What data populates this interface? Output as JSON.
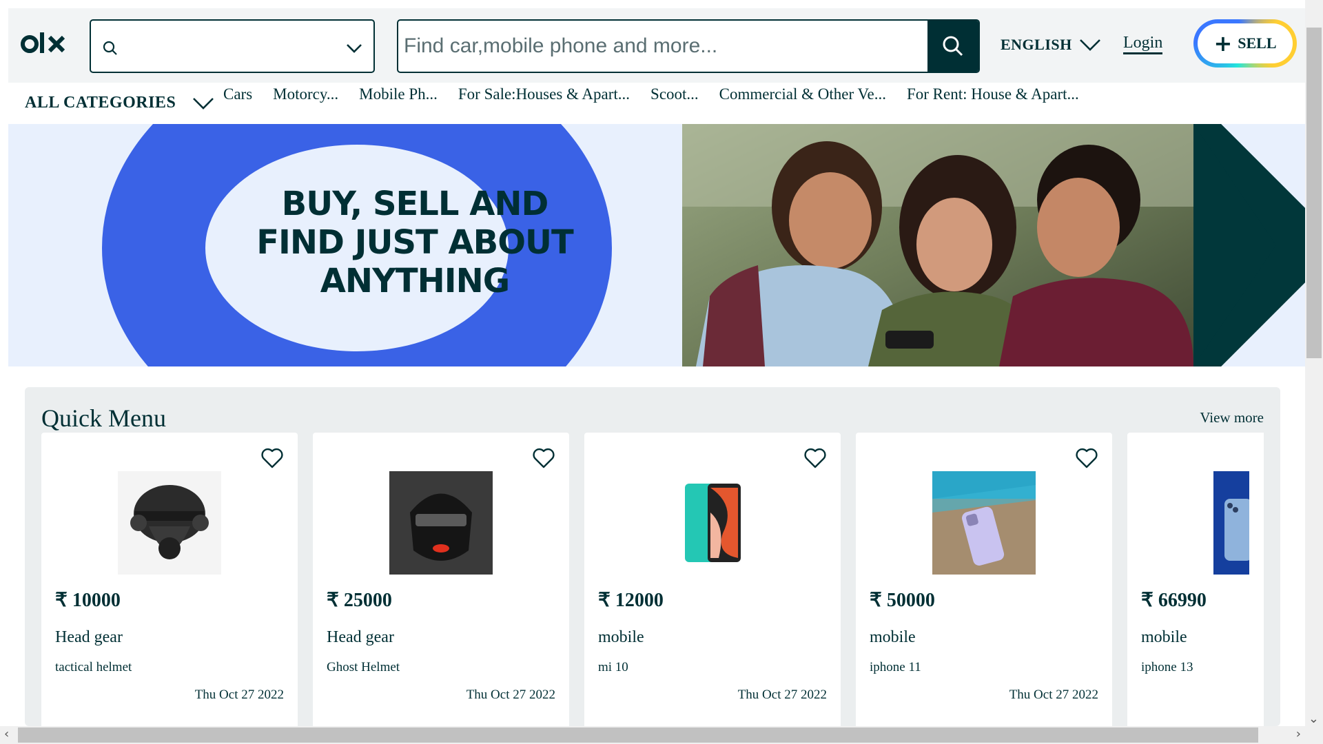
{
  "header": {
    "logo_text": "olx",
    "location_placeholder": "",
    "search_placeholder": "Find car,mobile phone and more...",
    "language": "ENGLISH",
    "login": "Login",
    "sell": "SELL"
  },
  "categories": {
    "all_label": "ALL CATEGORIES",
    "items": [
      {
        "label": "Cars"
      },
      {
        "label": "Motorcy..."
      },
      {
        "label": "Mobile Ph..."
      },
      {
        "label": "For Sale:Houses & Apart..."
      },
      {
        "label": "Scoot..."
      },
      {
        "label": "Commercial & Other Ve..."
      },
      {
        "label": "For Rent: House & Apart..."
      }
    ]
  },
  "banner": {
    "line1": "BUY, SELL AND",
    "line2": "FIND JUST ABOUT",
    "line3": "ANYTHING",
    "colors": {
      "ring": "#3a62e6",
      "background": "#e8f0fd",
      "dark": "#01373a"
    }
  },
  "quick_menu": {
    "title": "Quick Menu",
    "view_more": "View more",
    "cards": [
      {
        "price": "₹ 10000",
        "category": "Head gear",
        "title": "tactical helmet",
        "date": "Thu Oct 27 2022",
        "image": "helmet-tactical"
      },
      {
        "price": "₹ 25000",
        "category": "Head gear",
        "title": "Ghost Helmet",
        "date": "Thu Oct 27 2022",
        "image": "helmet-ghost"
      },
      {
        "price": "₹ 12000",
        "category": "mobile",
        "title": "mi 10",
        "date": "Thu Oct 27 2022",
        "image": "phone-mi10"
      },
      {
        "price": "₹ 50000",
        "category": "mobile",
        "title": "iphone 11",
        "date": "Thu Oct 27 2022",
        "image": "phone-iphone11"
      },
      {
        "price": "₹ 66990",
        "category": "mobile",
        "title": "iphone 13",
        "date": "",
        "image": "phone-iphone13"
      }
    ]
  },
  "colors": {
    "brand": "#002f34",
    "header_bg": "#f2f4f5",
    "section_bg": "#ebeeef"
  }
}
